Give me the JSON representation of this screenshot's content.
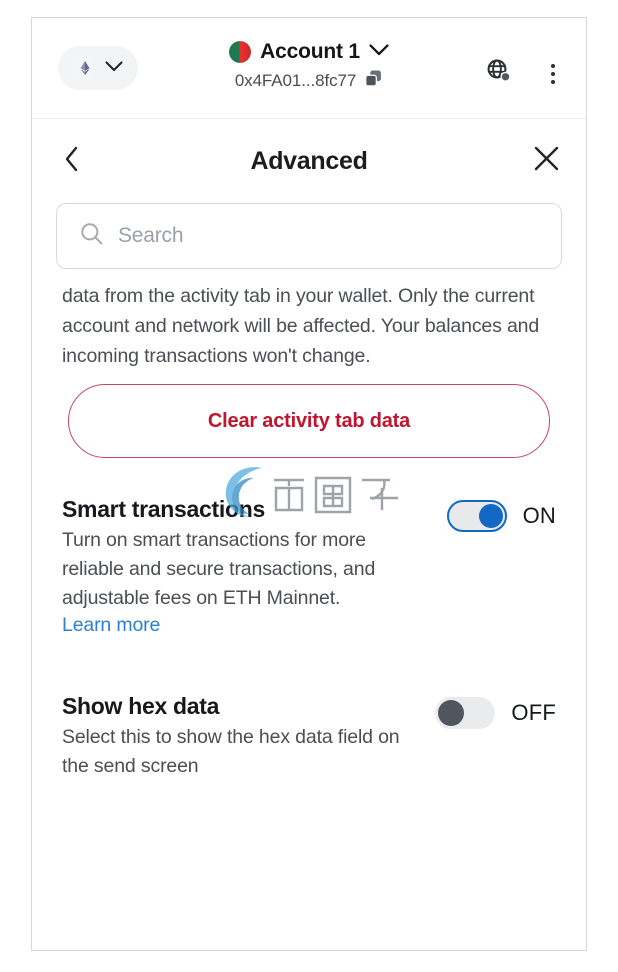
{
  "header": {
    "network_selector": {
      "token_icon": "ethereum-icon",
      "chevron_icon": "chevron-down-icon"
    },
    "account_name": "Account 1",
    "account_chevron_icon": "chevron-down-icon",
    "account_address": "0x4FA01...8fc77",
    "copy_icon": "copy-icon",
    "network_icon": "globe-network-icon",
    "menu_icon": "more-vertical-icon"
  },
  "titlebar": {
    "back_icon": "chevron-left-icon",
    "title": "Advanced",
    "close_icon": "close-x-icon"
  },
  "search": {
    "icon": "search-icon",
    "placeholder": "Search",
    "value": ""
  },
  "clear_activity": {
    "description": "data from the activity tab in your wallet. Only the current account and network will be affected. Your balances and incoming transactions won't change.",
    "button_label": "Clear activity tab data"
  },
  "settings": [
    {
      "title": "Smart transactions",
      "description": "Turn on smart transactions for more reliable and secure transactions, and adjustable fees on ETH Mainnet.",
      "link_label": "Learn more",
      "toggle_state": "ON"
    },
    {
      "title": "Show hex data",
      "description": "Select this to show the hex data field on the send screen",
      "toggle_state": "OFF"
    }
  ],
  "watermark": {
    "text": "币圈子",
    "logo_icon": "swoosh-logo-icon"
  },
  "colors": {
    "accent_blue": "#1268c3",
    "link_blue": "#2c7fd1",
    "danger_red": "#c0152f",
    "toggle_off_knob": "#50565e",
    "text_primary": "#16181b",
    "text_secondary": "#4b4e53"
  }
}
